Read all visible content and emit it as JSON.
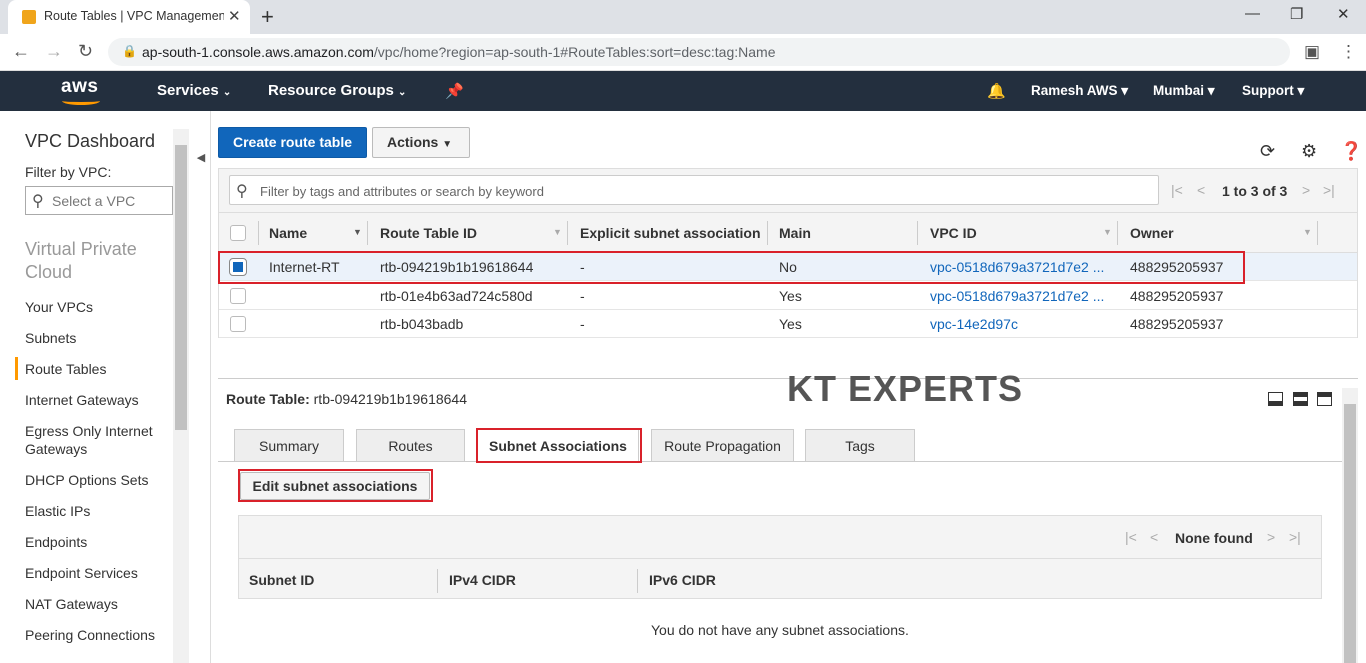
{
  "browser": {
    "tab_title": "Route Tables | VPC Management",
    "url_host": "ap-south-1.console.aws.amazon.com",
    "url_path": "/vpc/home?region=ap-south-1#RouteTables:sort=desc:tag:Name"
  },
  "aws_nav": {
    "logo": "aws",
    "services": "Services",
    "resource_groups": "Resource Groups",
    "account": "Ramesh AWS",
    "region": "Mumbai",
    "support": "Support"
  },
  "sidebar": {
    "dashboard": "VPC Dashboard",
    "filter_label": "Filter by VPC:",
    "filter_placeholder": "Select a VPC",
    "section": "Virtual Private Cloud",
    "items": [
      "Your VPCs",
      "Subnets",
      "Route Tables",
      "Internet Gateways",
      "Egress Only Internet Gateways",
      "DHCP Options Sets",
      "Elastic IPs",
      "Endpoints",
      "Endpoint Services",
      "NAT Gateways",
      "Peering Connections"
    ]
  },
  "toolbar": {
    "create_label": "Create route table",
    "actions_label": "Actions"
  },
  "grid": {
    "filter_placeholder": "Filter by tags and attributes or search by keyword",
    "pager_text": "1 to 3 of 3",
    "columns": [
      "Name",
      "Route Table ID",
      "Explicit subnet association",
      "Main",
      "VPC ID",
      "Owner"
    ],
    "rows": [
      {
        "name": "Internet-RT",
        "id": "rtb-094219b1b19618644",
        "assoc": "-",
        "main": "No",
        "vpc": "vpc-0518d679a3721d7e2 ...",
        "owner": "488295205937",
        "selected": true
      },
      {
        "name": "",
        "id": "rtb-01e4b63ad724c580d",
        "assoc": "-",
        "main": "Yes",
        "vpc": "vpc-0518d679a3721d7e2 ...",
        "owner": "488295205937",
        "selected": false
      },
      {
        "name": "",
        "id": "rtb-b043badb",
        "assoc": "-",
        "main": "Yes",
        "vpc": "vpc-14e2d97c",
        "owner": "488295205937",
        "selected": false
      }
    ]
  },
  "detail": {
    "label": "Route Table:",
    "id": "rtb-094219b1b19618644",
    "watermark": "KT EXPERTS",
    "tabs": [
      "Summary",
      "Routes",
      "Subnet Associations",
      "Route Propagation",
      "Tags"
    ],
    "edit_label": "Edit subnet associations",
    "sub_pager_text": "None found",
    "sub_columns": [
      "Subnet ID",
      "IPv4 CIDR",
      "IPv6 CIDR"
    ],
    "empty_message": "You do not have any subnet associations."
  },
  "colors": {
    "accent": "#1166bb",
    "highlight": "#d9212a",
    "aws_bar": "#232f3e",
    "aws_orange": "#ff9900"
  }
}
